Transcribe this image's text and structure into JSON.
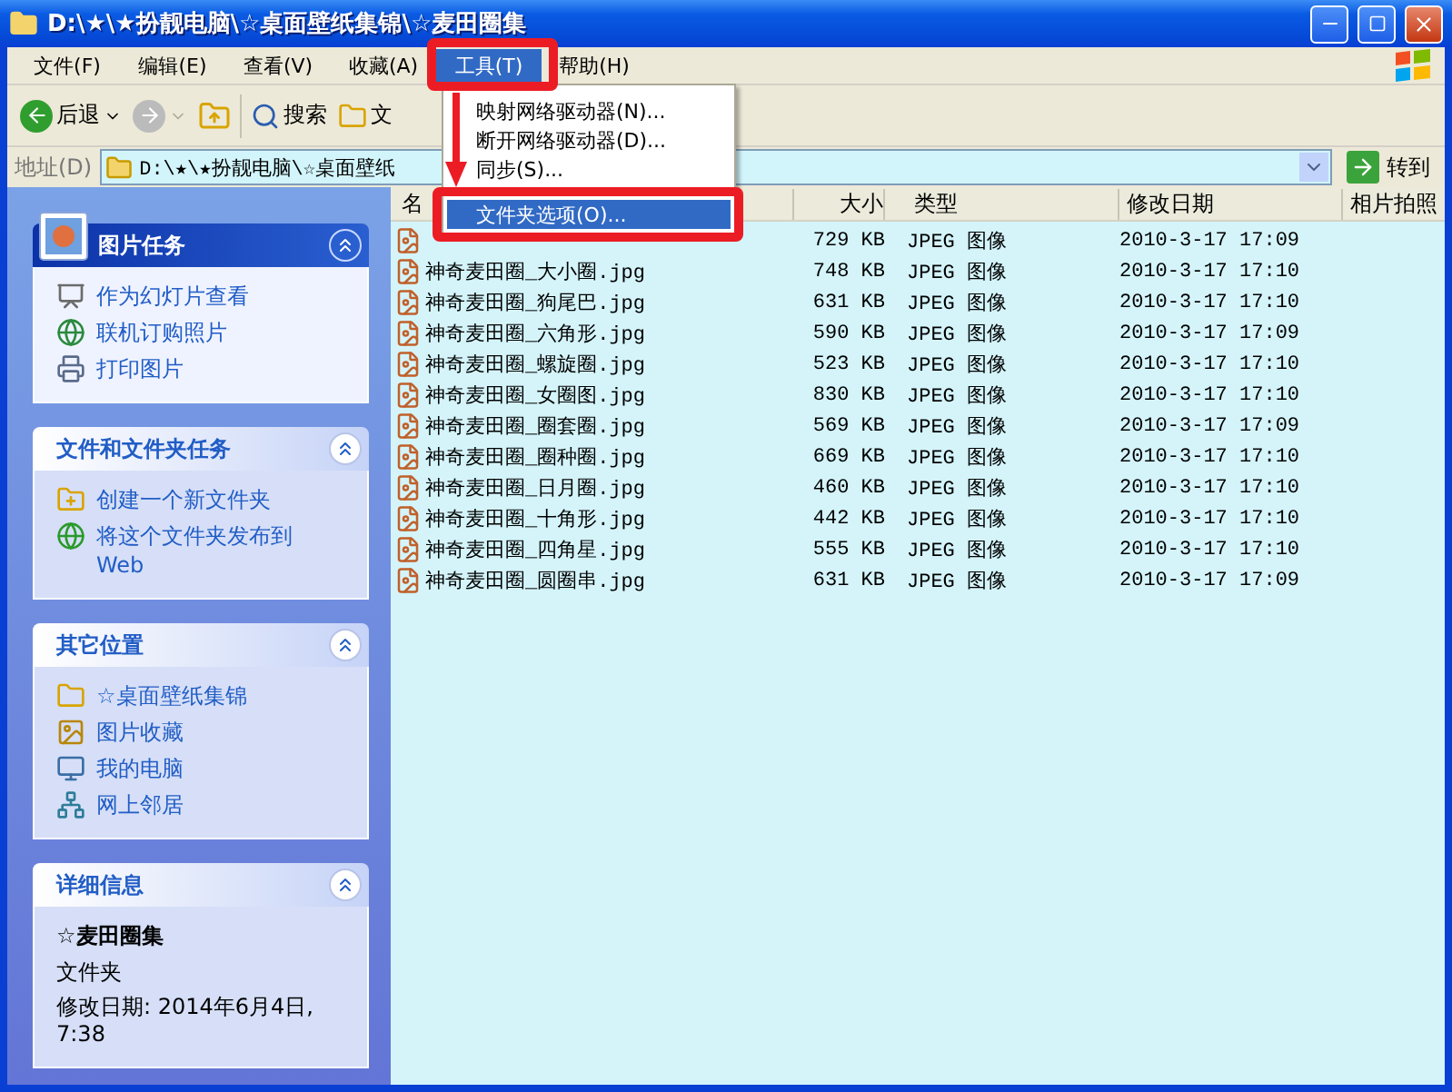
{
  "window": {
    "title": "D:\\★\\★扮靓电脑\\☆桌面壁纸集锦\\☆麦田圈集"
  },
  "menu_bar": [
    {
      "label": "文件(F)",
      "selected": false
    },
    {
      "label": "编辑(E)",
      "selected": false
    },
    {
      "label": "查看(V)",
      "selected": false
    },
    {
      "label": "收藏(A)",
      "selected": false
    },
    {
      "label": "工具(T)",
      "selected": true
    },
    {
      "label": "帮助(H)",
      "selected": false
    }
  ],
  "toolbar": [
    {
      "kind": "back",
      "label": "后退",
      "disabled": false
    },
    {
      "kind": "forward",
      "disabled": true
    },
    {
      "kind": "up",
      "disabled": false
    },
    {
      "kind": "search",
      "label": "搜索",
      "disabled": false
    },
    {
      "kind": "folders",
      "label": "文",
      "disabled": false
    }
  ],
  "address_bar": {
    "label": "地址(D)",
    "value": "D:\\★\\★扮靓电脑\\☆桌面壁纸",
    "go_button": "转到"
  },
  "tools_menu": [
    {
      "label": "映射网络驱动器(N)...",
      "selected": false,
      "separator_before": false
    },
    {
      "label": "断开网络驱动器(D)...",
      "selected": false,
      "separator_before": false
    },
    {
      "label": "同步(S)...",
      "selected": false,
      "separator_before": false
    },
    {
      "label": "文件夹选项(O)...",
      "selected": true,
      "separator_before": true
    }
  ],
  "sidebar": [
    {
      "kind": "links",
      "title": "图片任务",
      "emphasized": true,
      "items": [
        {
          "kind": "slideshow",
          "label": "作为幻灯片查看"
        },
        {
          "kind": "order",
          "label": "联机订购照片"
        },
        {
          "kind": "print",
          "label": "打印图片"
        }
      ]
    },
    {
      "kind": "links",
      "title": "文件和文件夹任务",
      "emphasized": false,
      "items": [
        {
          "kind": "new_folder",
          "label": "创建一个新文件夹"
        },
        {
          "kind": "publish",
          "label": "将这个文件夹发布到 Web"
        }
      ]
    },
    {
      "kind": "links",
      "title": "其它位置",
      "emphasized": false,
      "items": [
        {
          "kind": "folder",
          "label": "☆桌面壁纸集锦"
        },
        {
          "kind": "pictures",
          "label": "图片收藏"
        },
        {
          "kind": "computer",
          "label": "我的电脑"
        },
        {
          "kind": "network",
          "label": "网上邻居"
        }
      ]
    },
    {
      "kind": "details",
      "title": "详细信息",
      "emphasized": false,
      "name": "☆麦田圈集",
      "type": "文件夹",
      "modified": "修改日期: 2014年6月4日, 7:38"
    }
  ],
  "file_list": {
    "columns": [
      "名",
      "大小",
      "类型",
      "修改日期",
      "相片拍照"
    ],
    "rows": [
      {
        "size": "729 KB",
        "type": "JPEG 图像",
        "modified": "2010-3-17 17:09"
      },
      {
        "name": "神奇麦田圈_大小圈.jpg",
        "size": "748 KB",
        "type": "JPEG 图像",
        "modified": "2010-3-17 17:10"
      },
      {
        "name": "神奇麦田圈_狗尾巴.jpg",
        "size": "631 KB",
        "type": "JPEG 图像",
        "modified": "2010-3-17 17:10"
      },
      {
        "name": "神奇麦田圈_六角形.jpg",
        "size": "590 KB",
        "type": "JPEG 图像",
        "modified": "2010-3-17 17:09"
      },
      {
        "name": "神奇麦田圈_螺旋圈.jpg",
        "size": "523 KB",
        "type": "JPEG 图像",
        "modified": "2010-3-17 17:10"
      },
      {
        "name": "神奇麦田圈_女圈图.jpg",
        "size": "830 KB",
        "type": "JPEG 图像",
        "modified": "2010-3-17 17:10"
      },
      {
        "name": "神奇麦田圈_圈套圈.jpg",
        "size": "569 KB",
        "type": "JPEG 图像",
        "modified": "2010-3-17 17:09"
      },
      {
        "name": "神奇麦田圈_圈种圈.jpg",
        "size": "669 KB",
        "type": "JPEG 图像",
        "modified": "2010-3-17 17:10"
      },
      {
        "name": "神奇麦田圈_日月圈.jpg",
        "size": "460 KB",
        "type": "JPEG 图像",
        "modified": "2010-3-17 17:10"
      },
      {
        "name": "神奇麦田圈_十角形.jpg",
        "size": "442 KB",
        "type": "JPEG 图像",
        "modified": "2010-3-17 17:10"
      },
      {
        "name": "神奇麦田圈_四角星.jpg",
        "size": "555 KB",
        "type": "JPEG 图像",
        "modified": "2010-3-17 17:10"
      },
      {
        "name": "神奇麦田圈_圆圈串.jpg",
        "size": "631 KB",
        "type": "JPEG 图像",
        "modified": "2010-3-17 17:09"
      }
    ]
  }
}
